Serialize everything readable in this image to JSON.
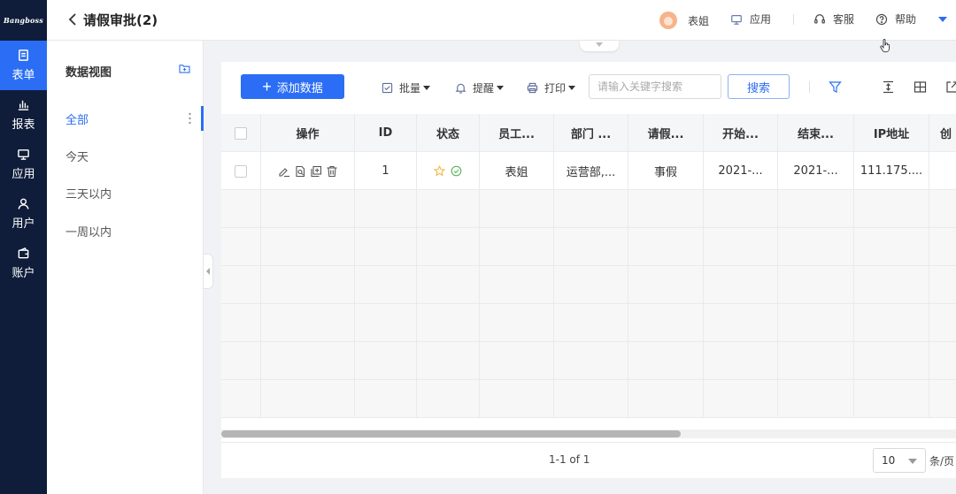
{
  "brand": {
    "logo_text": "Bangboss"
  },
  "nav": {
    "items": [
      {
        "label": "表单",
        "icon": "form-icon",
        "active": true
      },
      {
        "label": "报表",
        "icon": "chart-icon",
        "active": false
      },
      {
        "label": "应用",
        "icon": "monitor-icon",
        "active": false
      },
      {
        "label": "用户",
        "icon": "user-icon",
        "active": false
      },
      {
        "label": "账户",
        "icon": "wallet-icon",
        "active": false
      }
    ]
  },
  "header": {
    "title": "请假审批(2)",
    "user_name": "表姐",
    "app_label": "应用",
    "service_label": "客服",
    "help_label": "帮助"
  },
  "views": {
    "title": "数据视图",
    "items": [
      "全部",
      "今天",
      "三天以内",
      "一周以内"
    ],
    "active_index": 0
  },
  "toolbar": {
    "add_label": "添加数据",
    "batch_label": "批量",
    "remind_label": "提醒",
    "print_label": "打印",
    "search_placeholder": "请输入关键字搜索",
    "search_label": "搜索"
  },
  "table": {
    "columns": [
      "操作",
      "ID",
      "状态",
      "员工...",
      "部门 ...",
      "请假...",
      "开始...",
      "结束...",
      "IP地址",
      "创"
    ],
    "rows": [
      {
        "id": "1",
        "employee": "表姐",
        "department": "运营部,...",
        "leave_type": "事假",
        "start": "2021-...",
        "end": "2021-...",
        "ip": "111.175...."
      }
    ]
  },
  "pagination": {
    "summary": "1-1 of 1",
    "page_size": "10",
    "unit": "条/页"
  },
  "colors": {
    "accent": "#2b6ef5",
    "nav_bg": "#0f1d3a"
  }
}
